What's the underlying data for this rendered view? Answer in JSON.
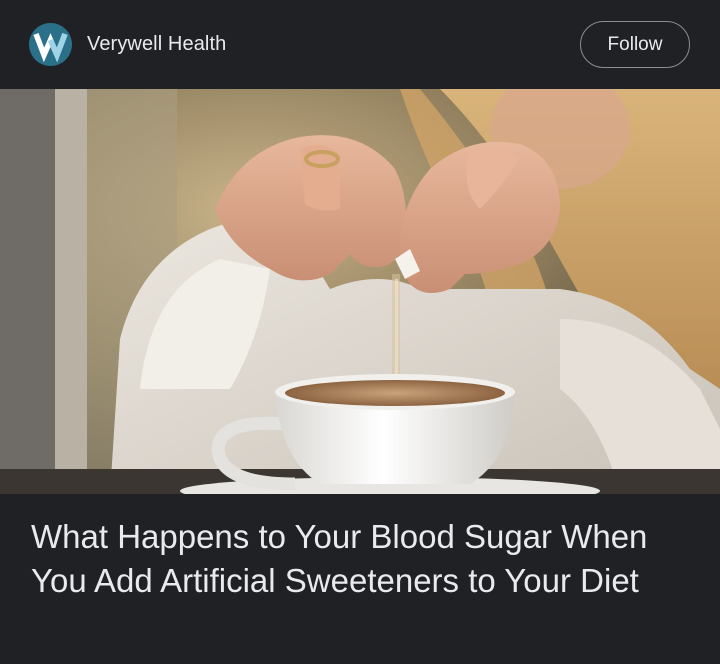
{
  "publisher": {
    "name": "Verywell Health",
    "logo_letter": "W",
    "logo_icon": "verywell-logo-icon"
  },
  "actions": {
    "follow_label": "Follow"
  },
  "article": {
    "image_icon": "photo-image",
    "headline": "What Happens to Your Blood Sugar When You Add Artificial Sweeteners to Your Diet"
  },
  "colors": {
    "background": "#202124",
    "text": "#e8eaed",
    "logo_bg": "#2a6f87",
    "button_border": "#8a8d91"
  }
}
